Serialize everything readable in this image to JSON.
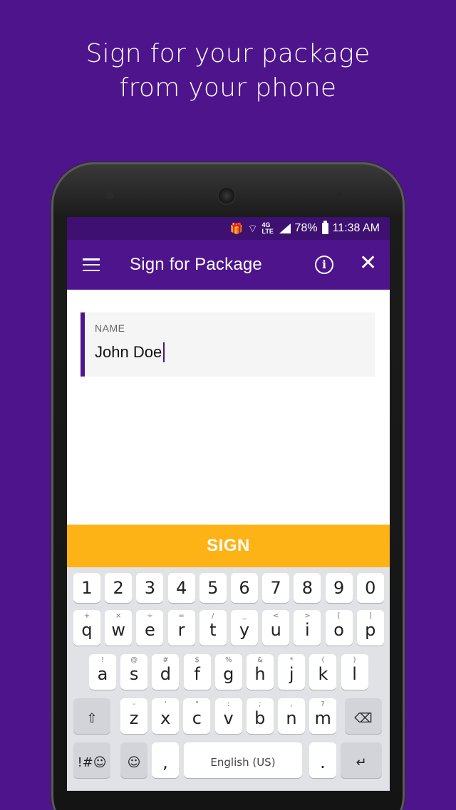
{
  "headline": {
    "line1": "Sign for your package",
    "line2": "from your phone"
  },
  "statusbar": {
    "network": "4G LTE",
    "battery": "78%",
    "time": "11:38 AM"
  },
  "toolbar": {
    "title": "Sign for Package"
  },
  "form": {
    "name_label": "NAME",
    "name_value": "John Doe"
  },
  "sign_button": {
    "label": "SIGN"
  },
  "keyboard": {
    "row_numbers": [
      "1",
      "2",
      "3",
      "4",
      "5",
      "6",
      "7",
      "8",
      "9",
      "0"
    ],
    "row1": [
      {
        "k": "q",
        "s": "+"
      },
      {
        "k": "w",
        "s": "×"
      },
      {
        "k": "e",
        "s": "÷"
      },
      {
        "k": "r",
        "s": "="
      },
      {
        "k": "t",
        "s": "/"
      },
      {
        "k": "y",
        "s": "_"
      },
      {
        "k": "u",
        "s": "<"
      },
      {
        "k": "i",
        "s": ">"
      },
      {
        "k": "o",
        "s": "["
      },
      {
        "k": "p",
        "s": "]"
      }
    ],
    "row2": [
      {
        "k": "a",
        "s": "!"
      },
      {
        "k": "s",
        "s": "@"
      },
      {
        "k": "d",
        "s": "#"
      },
      {
        "k": "f",
        "s": "$"
      },
      {
        "k": "g",
        "s": "%"
      },
      {
        "k": "h",
        "s": "&"
      },
      {
        "k": "j",
        "s": "*"
      },
      {
        "k": "k",
        "s": "("
      },
      {
        "k": "l",
        "s": ")"
      }
    ],
    "row3": [
      {
        "k": "z",
        "s": "-"
      },
      {
        "k": "x",
        "s": "'"
      },
      {
        "k": "c",
        "s": "\""
      },
      {
        "k": "v",
        "s": ":"
      },
      {
        "k": "b",
        "s": ";"
      },
      {
        "k": "n",
        "s": ","
      },
      {
        "k": "m",
        "s": "?"
      }
    ],
    "shift": "⇧",
    "backspace": "⌫",
    "symbols": "!#☺",
    "emoji": "☺",
    "comma": ",",
    "space": "English (US)",
    "period": ".",
    "enter": "↵"
  }
}
